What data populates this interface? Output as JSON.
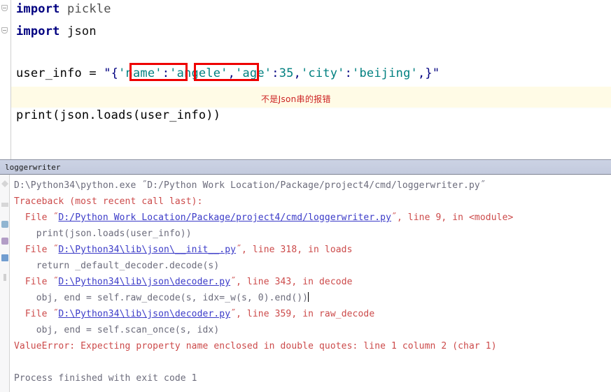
{
  "editor": {
    "lines": [
      {
        "id": "import-pickle",
        "tokens": [
          {
            "t": "import",
            "c": "kw"
          },
          {
            "t": " pickle",
            "c": "plain"
          }
        ]
      },
      {
        "id": "import-json",
        "tokens": [
          {
            "t": "import",
            "c": "kw"
          },
          {
            "t": " json",
            "c": "plainb"
          }
        ]
      },
      {
        "id": "user-info-assign",
        "tokens": [
          {
            "t": "user_info = ",
            "c": "ident"
          },
          {
            "t": "\"{",
            "c": "strq"
          },
          {
            "t": "'name'",
            "c": "str"
          },
          {
            "t": ":",
            "c": "strq"
          },
          {
            "t": "'angele'",
            "c": "str"
          },
          {
            "t": ",",
            "c": "strq"
          },
          {
            "t": "'age'",
            "c": "str"
          },
          {
            "t": ":",
            "c": "strq"
          },
          {
            "t": "35",
            "c": "str"
          },
          {
            "t": ",",
            "c": "strq"
          },
          {
            "t": "'city'",
            "c": "str"
          },
          {
            "t": ":",
            "c": "strq"
          },
          {
            "t": "'beijing'",
            "c": "str"
          },
          {
            "t": ",}\"",
            "c": "strq"
          }
        ]
      },
      {
        "id": "print-call",
        "tokens": [
          {
            "t": "print(json.loads(user_info))",
            "c": "ident"
          }
        ]
      }
    ],
    "full_string_line": "user_info = \"{'name':'angele','age':35,'city':'beijing',}\"",
    "print_line": "print(json.loads(user_info))",
    "annotation": "不是Json串的报错",
    "annotation_color": "#cc2222",
    "highlight_color": "#fffbe6",
    "redbox_color": "#ee0000",
    "boxed_tokens": [
      "'name'",
      "'angele'"
    ]
  },
  "console": {
    "tab_label": "loggerwriter",
    "toolbar_icons": [
      "rerun-icon",
      "stop-icon",
      "print-icon",
      "soft-wrap-icon",
      "scroll-to-end-icon",
      "clear-all-icon"
    ],
    "output": [
      {
        "id": "command-line",
        "style": "gray",
        "segments": [
          {
            "t": "D:\\Python34\\python.exe ˝D:/Python Work Location/Package/project4/cmd/loggerwriter.py˝",
            "k": "plain"
          }
        ]
      },
      {
        "id": "traceback-header",
        "style": "err",
        "segments": [
          {
            "t": "Traceback (most recent call last):",
            "k": "plain"
          }
        ]
      },
      {
        "id": "frame-1",
        "style": "err",
        "segments": [
          {
            "t": "  File ˝",
            "k": "plain"
          },
          {
            "t": "D:/Python Work Location/Package/project4/cmd/loggerwriter.py",
            "k": "link"
          },
          {
            "t": "˝, line 9, in <module>",
            "k": "plain"
          }
        ]
      },
      {
        "id": "frame-1-source",
        "style": "gray",
        "segments": [
          {
            "t": "    print(json.loads(user_info))",
            "k": "plain"
          }
        ]
      },
      {
        "id": "frame-2",
        "style": "err",
        "segments": [
          {
            "t": "  File ˝",
            "k": "plain"
          },
          {
            "t": "D:\\Python34\\lib\\json\\__init__.py",
            "k": "link"
          },
          {
            "t": "˝, line 318, in loads",
            "k": "plain"
          }
        ]
      },
      {
        "id": "frame-2-source",
        "style": "gray",
        "segments": [
          {
            "t": "    return _default_decoder.decode(s)",
            "k": "plain"
          }
        ]
      },
      {
        "id": "frame-3",
        "style": "err",
        "segments": [
          {
            "t": "  File ˝",
            "k": "plain"
          },
          {
            "t": "D:\\Python34\\lib\\json\\decoder.py",
            "k": "link"
          },
          {
            "t": "˝, line 343, in decode",
            "k": "plain"
          }
        ]
      },
      {
        "id": "frame-3-source",
        "style": "gray",
        "segments": [
          {
            "t": "    obj, end = self.raw_decode(s, idx=_w(s, 0).end())",
            "k": "plain"
          },
          {
            "t": "",
            "k": "caret"
          }
        ]
      },
      {
        "id": "frame-4",
        "style": "err",
        "segments": [
          {
            "t": "  File ˝",
            "k": "plain"
          },
          {
            "t": "D:\\Python34\\lib\\json\\decoder.py",
            "k": "link"
          },
          {
            "t": "˝, line 359, in raw_decode",
            "k": "plain"
          }
        ]
      },
      {
        "id": "frame-4-source",
        "style": "gray",
        "segments": [
          {
            "t": "    obj, end = self.scan_once(s, idx)",
            "k": "plain"
          }
        ]
      },
      {
        "id": "exception-line",
        "style": "exc",
        "segments": [
          {
            "t": "ValueError: Expecting property name enclosed in double quotes: line 1 column 2 (char 1)",
            "k": "plain"
          }
        ]
      },
      {
        "id": "blank-line",
        "style": "blank",
        "segments": [
          {
            "t": " ",
            "k": "plain"
          }
        ]
      },
      {
        "id": "process-finished",
        "style": "gray",
        "segments": [
          {
            "t": "Process finished with exit code 1",
            "k": "plain"
          }
        ]
      }
    ],
    "exit_code": "1"
  }
}
